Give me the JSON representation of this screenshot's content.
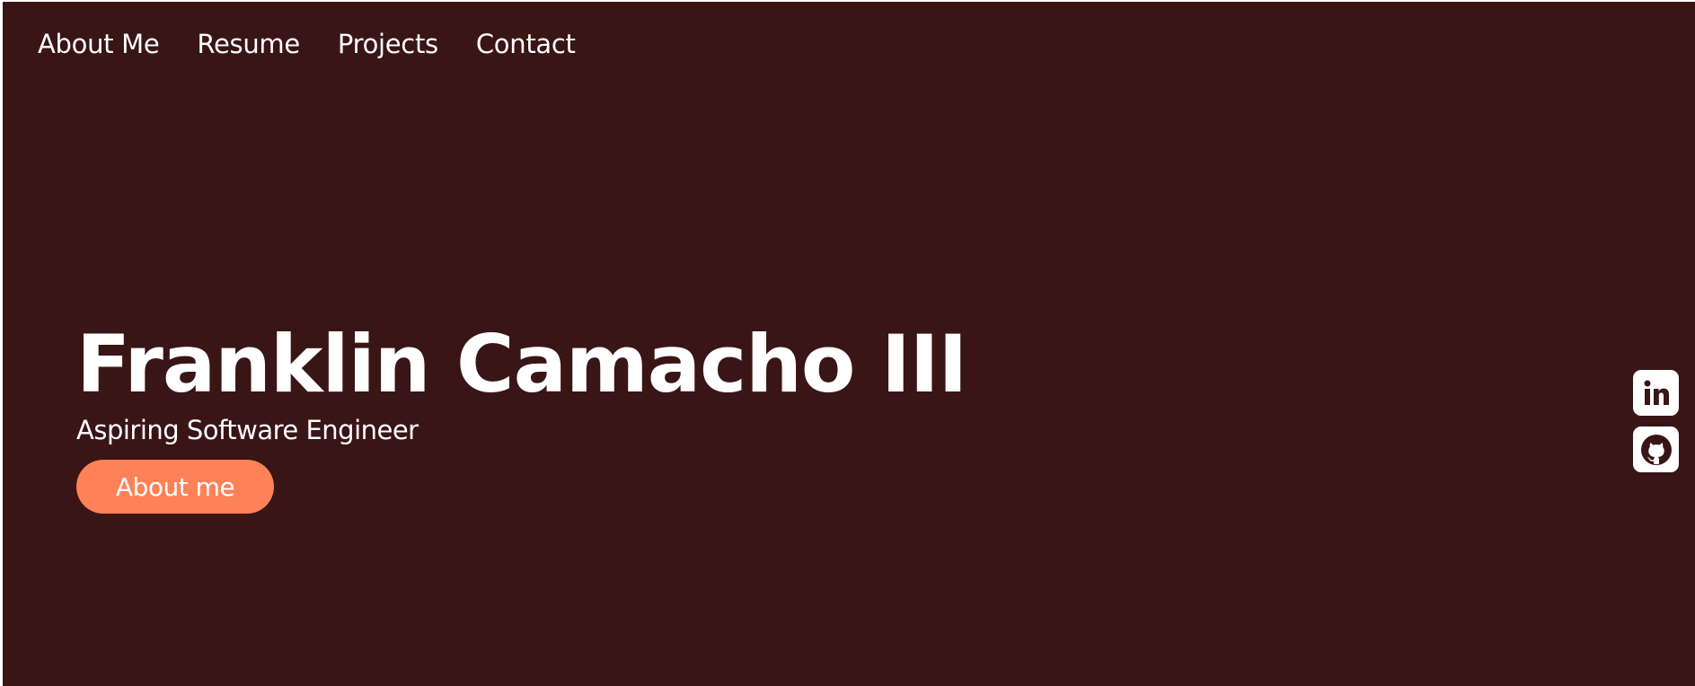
{
  "nav": {
    "items": [
      {
        "label": "About Me"
      },
      {
        "label": "Resume"
      },
      {
        "label": "Projects"
      },
      {
        "label": "Contact"
      }
    ]
  },
  "hero": {
    "title": "Franklin Camacho III",
    "subtitle": "Aspiring Software Engineer",
    "cta_label": "About me"
  },
  "social": {
    "items": [
      {
        "icon": "linkedin-icon"
      },
      {
        "icon": "github-icon"
      }
    ]
  },
  "colors": {
    "background": "#3a1515",
    "accent": "#ff8157",
    "text": "#ffffff"
  }
}
